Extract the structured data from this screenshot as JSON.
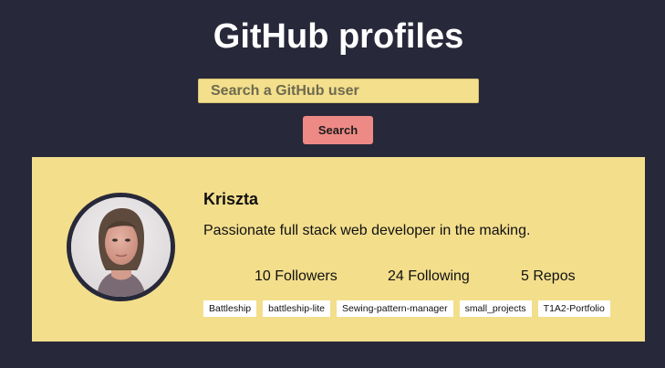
{
  "page": {
    "title": "GitHub profiles"
  },
  "search": {
    "placeholder": "Search a GitHub user",
    "value": "",
    "button_label": "Search"
  },
  "profile": {
    "name": "Kriszta",
    "bio": "Passionate full stack web developer in the making.",
    "followers": "10 Followers",
    "following": "24 Following",
    "repos_count": "5 Repos",
    "repos": [
      "Battleship",
      "battleship-lite",
      "Sewing-pattern-manager",
      "small_projects",
      "T1A2-Portfolio"
    ]
  },
  "colors": {
    "background": "#272839",
    "accent_yellow": "#f3de8c",
    "button_pink": "#ee8a85",
    "text_dark": "#111111"
  }
}
